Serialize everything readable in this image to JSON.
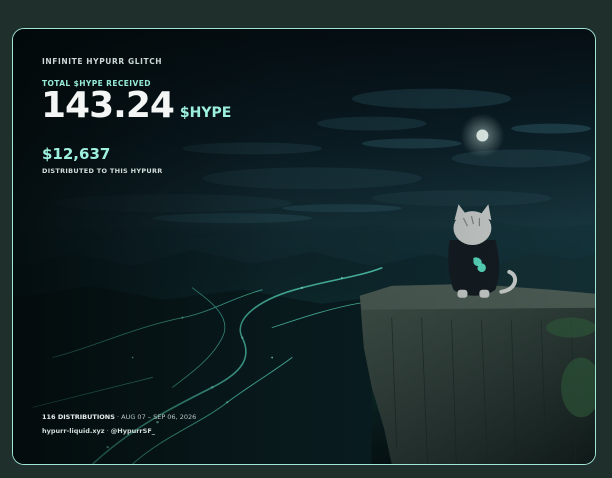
{
  "card": {
    "title": "INFINITE HYPURR GLITCH",
    "total_label": "TOTAL $HYPE RECEIVED",
    "amount": "143.24",
    "unit": "$HYPE",
    "usd_value": "$12,637",
    "usd_caption": "DISTRIBUTED TO THIS HYPURR",
    "distributions": "116 DISTRIBUTIONS",
    "date_range": " · AUG 07 – SEP 06, 2026",
    "site": "hypurr-liquid.xyz",
    "separator": " · ",
    "handle": "@HypurrSF_"
  },
  "colors": {
    "border": "#9fe6d6",
    "accent": "#9ef0de",
    "background": "#1e2f2c"
  },
  "illustration": {
    "subject": "cat in hoodie on cliff overlooking glowing valley at night",
    "icons": [
      "moon-icon"
    ]
  }
}
